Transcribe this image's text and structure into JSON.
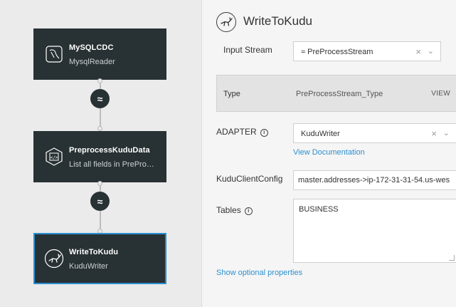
{
  "canvas": {
    "nodes": [
      {
        "title": "MySQLCDC",
        "subtitle": "MysqlReader",
        "icon": "database-source-icon",
        "selected": false
      },
      {
        "title": "PreprocessKuduData",
        "subtitle": "List all fields in PreProce…",
        "icon": "code-query-icon",
        "selected": false
      },
      {
        "title": "WriteToKudu",
        "subtitle": "KuduWriter",
        "icon": "kudu-antelope-icon",
        "selected": true
      }
    ],
    "streams": [
      {
        "icon": "stream-waves-icon",
        "glyph": "≈"
      },
      {
        "icon": "stream-waves-icon",
        "glyph": "≈"
      }
    ]
  },
  "panel": {
    "title": "WriteToKudu",
    "title_icon": "kudu-antelope-icon",
    "input_stream": {
      "label": "Input Stream",
      "glyph": "≈",
      "value": "PreProcessStream"
    },
    "type_row": {
      "label": "Type",
      "value": "PreProcessStream_Type",
      "action": "VIEW"
    },
    "adapter": {
      "label": "ADAPTER",
      "value": "KuduWriter",
      "doc_link": "View Documentation"
    },
    "kudu_client_config": {
      "label": "KuduClientConfig",
      "value": "master.addresses->ip-172-31-31-54.us-wes"
    },
    "tables": {
      "label": "Tables",
      "value": "BUSINESS"
    },
    "optional_link": "Show optional properties"
  },
  "colors": {
    "node_bg": "#283134",
    "accent_blue": "#2b8fcf",
    "canvas_bg": "#ebebeb",
    "panel_bg": "#f5f5f5"
  }
}
